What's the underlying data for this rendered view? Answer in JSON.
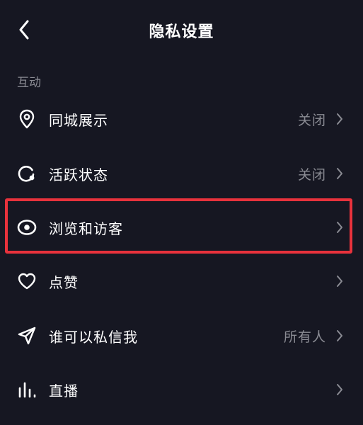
{
  "header": {
    "title": "隐私设置"
  },
  "section": {
    "label": "互动"
  },
  "items": [
    {
      "label": "同城展示",
      "value": "关闭",
      "icon": "location-pin-icon"
    },
    {
      "label": "活跃状态",
      "value": "关闭",
      "icon": "active-status-icon"
    },
    {
      "label": "浏览和访客",
      "value": "",
      "icon": "eye-icon"
    },
    {
      "label": "点赞",
      "value": "",
      "icon": "heart-icon"
    },
    {
      "label": "谁可以私信我",
      "value": "所有人",
      "icon": "send-message-icon"
    },
    {
      "label": "直播",
      "value": "",
      "icon": "live-bars-icon"
    }
  ],
  "colors": {
    "background": "#161722",
    "highlight_border": "#e8323c",
    "secondary_text": "#8a8b93"
  }
}
